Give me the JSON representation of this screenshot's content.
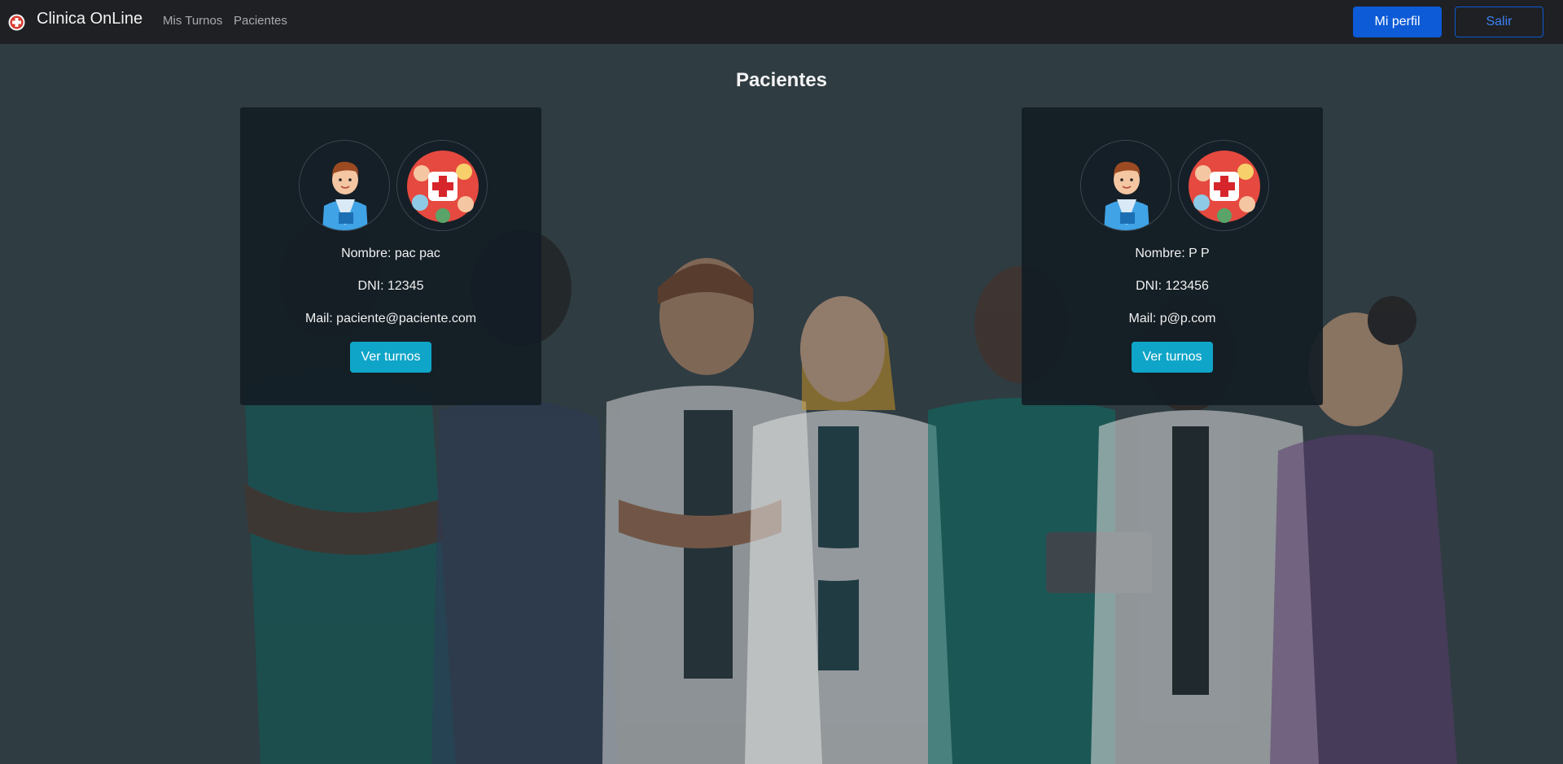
{
  "navbar": {
    "brand": "Clinica OnLine",
    "links": [
      "Mis Turnos",
      "Pacientes"
    ],
    "profile_button": "Mi perfil",
    "logout_button": "Salir"
  },
  "page": {
    "title": "Pacientes"
  },
  "patients": [
    {
      "name_line": "Nombre: pac pac",
      "dni_line": "DNI: 12345",
      "mail_line": "Mail: paciente@paciente.com",
      "button": "Ver turnos"
    },
    {
      "name_line": "Nombre: P P",
      "dni_line": "DNI: 123456",
      "mail_line": "Mail: p@p.com",
      "button": "Ver turnos"
    }
  ],
  "colors": {
    "navbar_bg": "#1f2023",
    "page_bg": "#2f3c42",
    "primary": "#0d5bd6",
    "info": "#0fa5c8",
    "card_bg": "#131d25"
  },
  "icons": [
    "clinic-logo-icon",
    "patient-avatar-icon",
    "medical-cross-avatar-icon"
  ]
}
